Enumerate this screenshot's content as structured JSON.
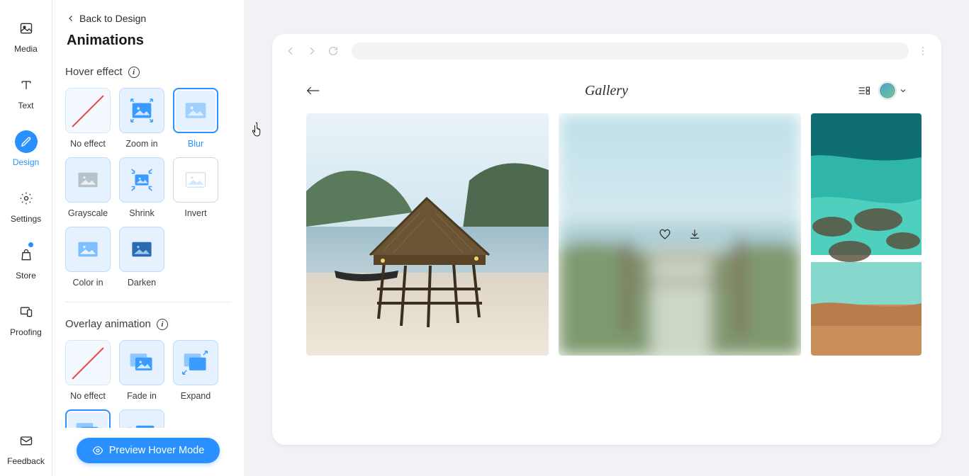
{
  "rail": {
    "media": "Media",
    "text": "Text",
    "design": "Design",
    "settings": "Settings",
    "store": "Store",
    "proofing": "Proofing",
    "feedback": "Feedback"
  },
  "panel": {
    "back_label": "Back to Design",
    "title": "Animations",
    "hover_label": "Hover effect",
    "overlay_label": "Overlay animation",
    "hover_options": {
      "no_effect": "No effect",
      "zoom_in": "Zoom in",
      "blur": "Blur",
      "grayscale": "Grayscale",
      "shrink": "Shrink",
      "invert": "Invert",
      "color_in": "Color in",
      "darken": "Darken"
    },
    "overlay_options": {
      "no_effect": "No effect",
      "fade_in": "Fade in",
      "expand": "Expand"
    },
    "preview_button": "Preview Hover Mode"
  },
  "preview": {
    "gallery_title": "Gallery"
  }
}
